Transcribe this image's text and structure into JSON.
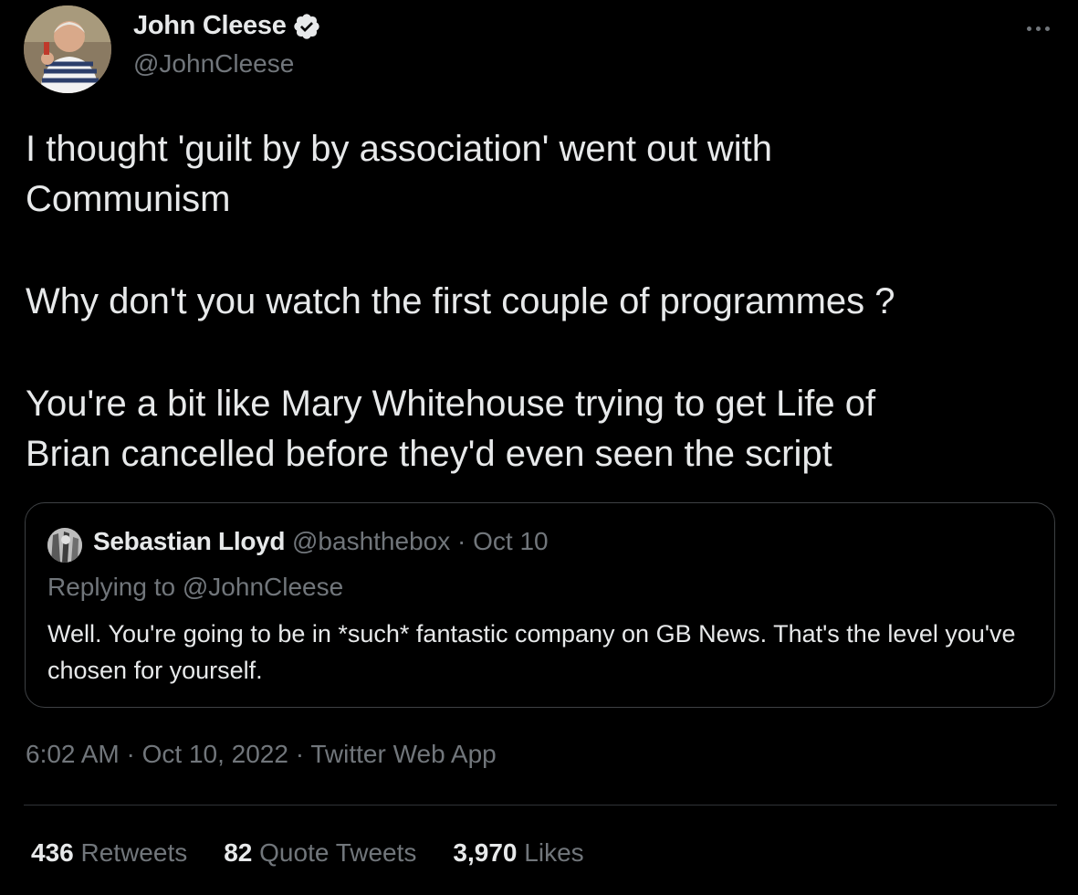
{
  "author": {
    "name": "John Cleese",
    "handle": "@JohnCleese",
    "verified": true
  },
  "more_icon": "more-horizontal-icon",
  "tweet_text": {
    "line1": "I thought 'guilt by by association' went out with",
    "line2": "Communism",
    "line3": "Why don't you watch the first couple of programmes ?",
    "line4": "You're a bit like Mary Whitehouse trying to get Life of",
    "line5": "Brian cancelled before they'd even seen the script"
  },
  "quote": {
    "name": "Sebastian Lloyd",
    "handle": "@bashthebox",
    "separator": "·",
    "date": "Oct 10",
    "replying_prefix": "Replying to",
    "replying_to": "@JohnCleese",
    "text": "Well. You're going to be in *such* fantastic company on GB News. That's the level you've chosen for yourself."
  },
  "meta": {
    "time": "6:02 AM",
    "separator": "·",
    "date": "Oct 10, 2022",
    "source": "Twitter Web App"
  },
  "stats": {
    "retweets_count": "436",
    "retweets_label": "Retweets",
    "quotes_count": "82",
    "quotes_label": "Quote Tweets",
    "likes_count": "3,970",
    "likes_label": "Likes"
  },
  "colors": {
    "background": "#000000",
    "text_primary": "#e7e9ea",
    "text_secondary": "#71767b",
    "border": "#2f3336"
  }
}
